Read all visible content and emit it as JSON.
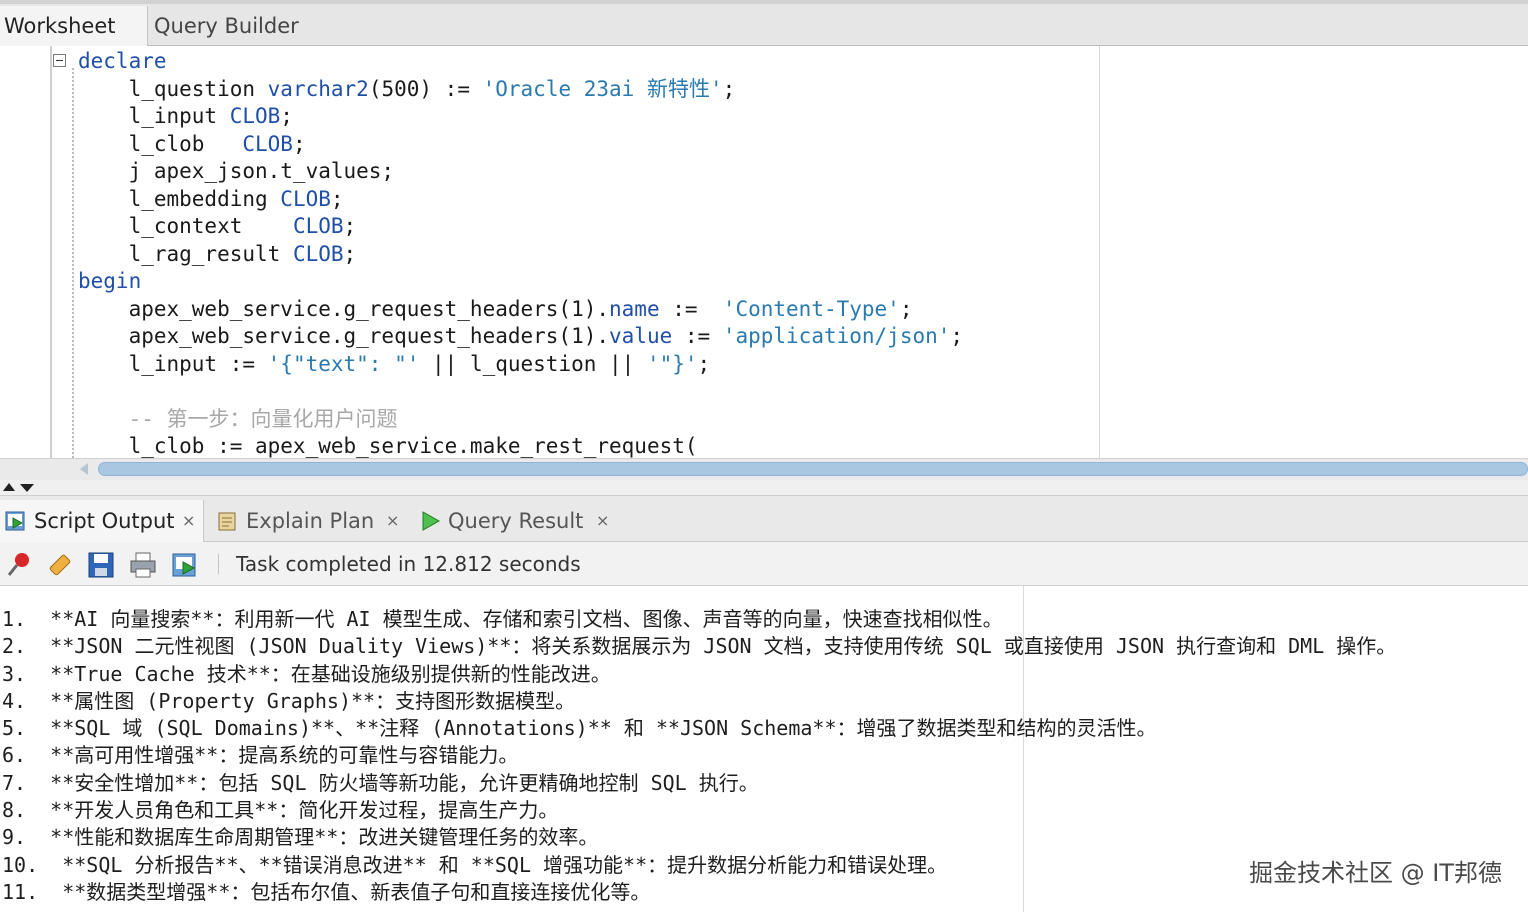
{
  "top_tabs": {
    "worksheet": "Worksheet",
    "query_builder": "Query Builder"
  },
  "code_lines": [
    [
      {
        "t": "declare",
        "c": "kw"
      }
    ],
    [
      {
        "t": "    l_question "
      },
      {
        "t": "varchar2",
        "c": "kw"
      },
      {
        "t": "(500) := "
      },
      {
        "t": "'Oracle 23ai 新特性'",
        "c": "str"
      },
      {
        "t": ";"
      }
    ],
    [
      {
        "t": "    l_input "
      },
      {
        "t": "CLOB",
        "c": "kw"
      },
      {
        "t": ";"
      }
    ],
    [
      {
        "t": "    l_clob   "
      },
      {
        "t": "CLOB",
        "c": "kw"
      },
      {
        "t": ";"
      }
    ],
    [
      {
        "t": "    j apex_json.t_values;"
      }
    ],
    [
      {
        "t": "    l_embedding "
      },
      {
        "t": "CLOB",
        "c": "kw"
      },
      {
        "t": ";"
      }
    ],
    [
      {
        "t": "    l_context    "
      },
      {
        "t": "CLOB",
        "c": "kw"
      },
      {
        "t": ";"
      }
    ],
    [
      {
        "t": "    l_rag_result "
      },
      {
        "t": "CLOB",
        "c": "kw"
      },
      {
        "t": ";"
      }
    ],
    [
      {
        "t": "begin",
        "c": "kw"
      }
    ],
    [
      {
        "t": "    apex_web_service.g_request_headers(1)."
      },
      {
        "t": "name",
        "c": "kw"
      },
      {
        "t": " :=  "
      },
      {
        "t": "'Content-Type'",
        "c": "str"
      },
      {
        "t": ";"
      }
    ],
    [
      {
        "t": "    apex_web_service.g_request_headers(1)."
      },
      {
        "t": "value",
        "c": "kw"
      },
      {
        "t": " := "
      },
      {
        "t": "'application/json'",
        "c": "str"
      },
      {
        "t": ";"
      }
    ],
    [
      {
        "t": "    l_input := "
      },
      {
        "t": "'{\"text\": \"'",
        "c": "str"
      },
      {
        "t": " || l_question || "
      },
      {
        "t": "'\"}'",
        "c": "str"
      },
      {
        "t": ";"
      }
    ],
    [
      {
        "t": ""
      }
    ],
    [
      {
        "t": "    -- 第一步：向量化用户问题",
        "c": "cmt"
      }
    ],
    [
      {
        "t": "    l_clob := apex_web_service.make_rest_request("
      }
    ]
  ],
  "output_tabs": [
    {
      "label": "Script Output",
      "close": "×",
      "icon": "script-output-icon"
    },
    {
      "label": "Explain Plan",
      "close": "×",
      "icon": "explain-plan-icon"
    },
    {
      "label": "Query Result",
      "close": "×",
      "icon": "query-result-icon"
    }
  ],
  "toolbar": {
    "status": "Task completed in 12.812 seconds",
    "icons": [
      "pin-icon",
      "eraser-icon",
      "save-icon",
      "print-icon",
      "export-icon"
    ]
  },
  "output_lines": [
    "1.  **AI 向量搜索**：利用新一代 AI 模型生成、存储和索引文档、图像、声音等的向量，快速查找相似性。",
    "2.  **JSON 二元性视图 (JSON Duality Views)**：将关系数据展示为 JSON 文档，支持使用传统 SQL 或直接使用 JSON 执行查询和 DML 操作。",
    "3.  **True Cache 技术**：在基础设施级别提供新的性能改进。",
    "4.  **属性图 (Property Graphs)**：支持图形数据模型。",
    "5.  **SQL 域 (SQL Domains)**、**注释 (Annotations)** 和 **JSON Schema**：增强了数据类型和结构的灵活性。",
    "6.  **高可用性增强**：提高系统的可靠性与容错能力。",
    "7.  **安全性增加**：包括 SQL 防火墙等新功能，允许更精确地控制 SQL 执行。",
    "8.  **开发人员角色和工具**：简化开发过程，提高生产力。",
    "9.  **性能和数据库生命周期管理**：改进关键管理任务的效率。",
    "10.  **SQL 分析报告**、**错误消息改进** 和 **SQL 增强功能**：提升数据分析能力和错误处理。",
    "11.  **数据类型增强**：包括布尔值、新表值子句和直接连接优化等。"
  ],
  "watermark": "掘金技术社区 @ IT邦德",
  "colors": {
    "keyword": "#1f4fa8",
    "string": "#2a7ab0",
    "comment": "#a8a8a8",
    "scroll_thumb": "#aac7e2"
  }
}
